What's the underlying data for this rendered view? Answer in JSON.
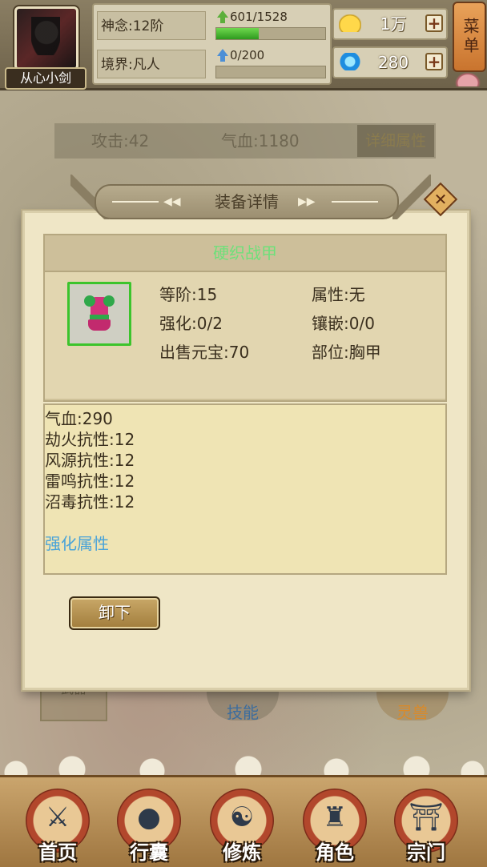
{
  "player": {
    "name": "从心小剑",
    "shennian": "神念:12阶",
    "jingjie": "境界:凡人",
    "exp1": {
      "text": "601/1528",
      "fraction": 0.39
    },
    "exp2": {
      "text": "0/200",
      "fraction": 0
    }
  },
  "currency": {
    "gold": "1万",
    "gem": "280"
  },
  "menu_label": "菜单",
  "attributes": {
    "attack": "攻击:42",
    "hp": "气血:1180",
    "detail_button": "详细属性"
  },
  "background_tabs": {
    "weapon": "武器",
    "skill": "技能",
    "beast": "灵兽"
  },
  "modal": {
    "title": "装备详情",
    "item_name": "硬织战甲",
    "info": {
      "rank": "等阶:15",
      "element": "属性:无",
      "enhance": "强化:0/2",
      "inlay": "镶嵌:0/0",
      "sell": "出售元宝:70",
      "slot": "部位:胸甲"
    },
    "stats": [
      "气血:290",
      "劫火抗性:12",
      "风源抗性:12",
      "雷鸣抗性:12",
      "沼毒抗性:12"
    ],
    "enhance_link": "强化属性",
    "unequip_button": "卸下"
  },
  "nav": [
    {
      "label": "首页",
      "icon": "crossed-swords-icon"
    },
    {
      "label": "行囊",
      "icon": "bag-icon"
    },
    {
      "label": "修炼",
      "icon": "meditation-icon"
    },
    {
      "label": "角色",
      "icon": "character-icon"
    },
    {
      "label": "宗门",
      "icon": "gate-icon"
    }
  ],
  "colors": {
    "item_name": "#6ee07a",
    "enhance_link": "#4aa3d8",
    "rarity_border": "#3cc42c"
  }
}
